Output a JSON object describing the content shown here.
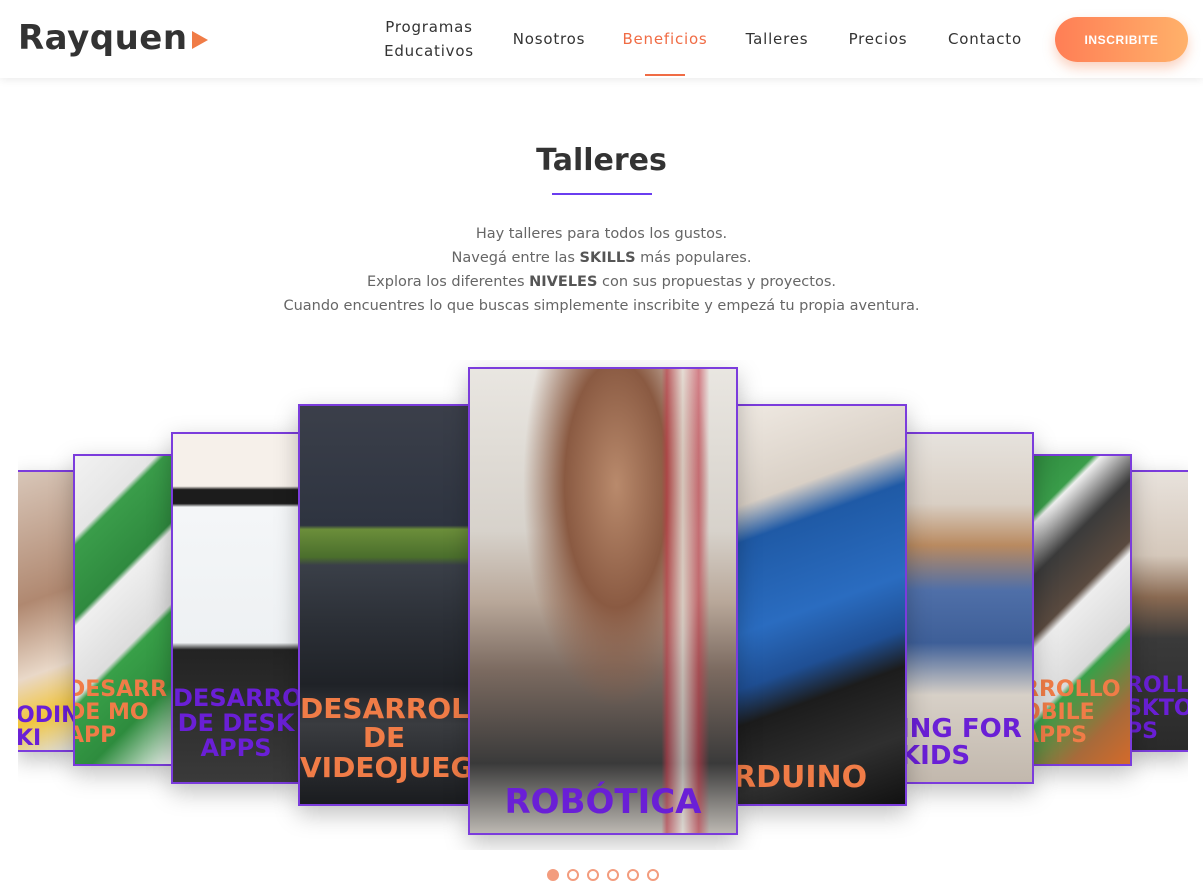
{
  "header": {
    "logo": "Rayquen",
    "nav": [
      {
        "line1": "Programas",
        "line2": "Educativos"
      },
      {
        "label": "Nosotros"
      },
      {
        "label": "Beneficios"
      },
      {
        "label": "Talleres"
      },
      {
        "label": "Precios"
      },
      {
        "label": "Contacto"
      }
    ],
    "cta": "INSCRIBITE"
  },
  "section": {
    "title": "Talleres",
    "intro": {
      "line1": "Hay talleres para todos los gustos.",
      "line2_pre": "Navegá entre las ",
      "line2_bold": "SKILLS",
      "line2_post": " más populares.",
      "line3_pre": "Explora los diferentes ",
      "line3_bold": "NIVELES",
      "line3_post": " con sus propuestas y proyectos.",
      "line4": "Cuando encuentres lo que buscas simplemente inscribite y empezá tu propia aventura."
    }
  },
  "carousel": {
    "cards": [
      {
        "caption": "ODIN\nKI",
        "color": "#6a1fd6"
      },
      {
        "caption": "DESARR\nDE MO\nAPP",
        "color": "#f07c47"
      },
      {
        "caption": "DESARRO\nDE DESK\nAPPS",
        "color": "#6a1fd6"
      },
      {
        "caption": "DESARROL\nDE\nVIDEOJUEG",
        "color": "#f07c47"
      },
      {
        "caption": "ROBÓTICA",
        "color": "#6a1fd6"
      },
      {
        "caption": "RDUINO",
        "color": "#f07c47"
      },
      {
        "caption": "ING FOR\nKIDS",
        "color": "#6a1fd6"
      },
      {
        "caption": "RROLLO\nOBILE\nAPPS",
        "color": "#f07c47"
      },
      {
        "caption": "ROLL\nSKTO\nPS",
        "color": "#6a1fd6"
      }
    ],
    "dots": 6,
    "active_dot": 0
  }
}
